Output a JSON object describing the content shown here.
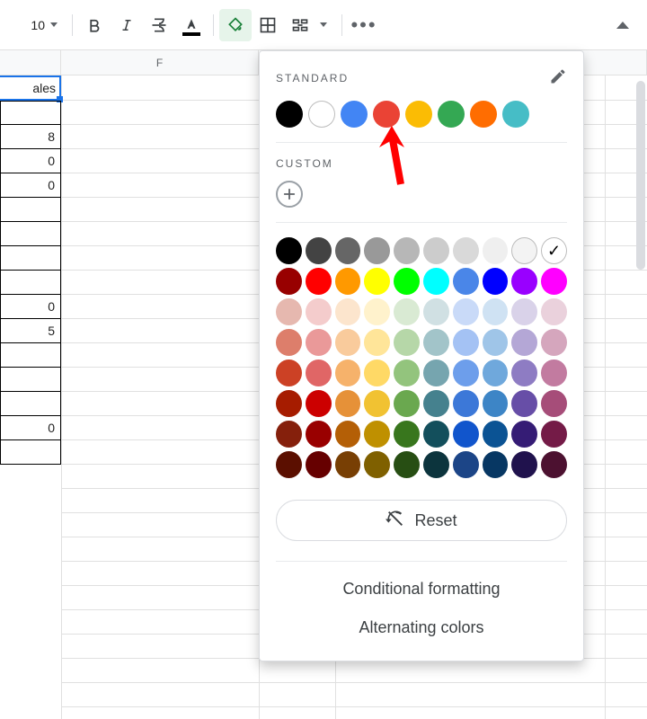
{
  "toolbar": {
    "font_size": "10"
  },
  "columns": {
    "f_label": "F"
  },
  "selected_cell": {
    "text": "ales"
  },
  "data_cells": [
    "",
    "8",
    "0",
    "0",
    "",
    "",
    "",
    "",
    "0",
    "5",
    "",
    "",
    "",
    "0",
    ""
  ],
  "popup": {
    "standard_label": "STANDARD",
    "custom_label": "CUSTOM",
    "reset_label": "Reset",
    "conditional_label": "Conditional formatting",
    "alternating_label": "Alternating colors",
    "standard_colors": [
      "#000000",
      "#ffffff",
      "#4285f4",
      "#ea4335",
      "#fbbc04",
      "#34a853",
      "#ff6d01",
      "#46bdc6"
    ],
    "palette_rows": [
      [
        "#000000",
        "#434343",
        "#666666",
        "#999999",
        "#b7b7b7",
        "#cccccc",
        "#d9d9d9",
        "#efefef",
        "#f3f3f3",
        "check-white"
      ],
      [
        "#980000",
        "#ff0000",
        "#ff9900",
        "#ffff00",
        "#00ff00",
        "#00ffff",
        "#4a86e8",
        "#0000ff",
        "#9900ff",
        "#ff00ff"
      ],
      [
        "#e6b8af",
        "#f4cccc",
        "#fce5cd",
        "#fff2cc",
        "#d9ead3",
        "#d0e0e3",
        "#c9daf8",
        "#cfe2f3",
        "#d9d2e9",
        "#ead1dc"
      ],
      [
        "#dd7e6b",
        "#ea9999",
        "#f9cb9c",
        "#ffe599",
        "#b6d7a8",
        "#a2c4c9",
        "#a4c2f4",
        "#9fc5e8",
        "#b4a7d6",
        "#d5a6bd"
      ],
      [
        "#cc4125",
        "#e06666",
        "#f6b26b",
        "#ffd966",
        "#93c47d",
        "#76a5af",
        "#6d9eeb",
        "#6fa8dc",
        "#8e7cc3",
        "#c27ba0"
      ],
      [
        "#a61c00",
        "#cc0000",
        "#e69138",
        "#f1c232",
        "#6aa84f",
        "#45818e",
        "#3c78d8",
        "#3d85c6",
        "#674ea7",
        "#a64d79"
      ],
      [
        "#85200c",
        "#990000",
        "#b45f06",
        "#bf9000",
        "#38761d",
        "#134f5c",
        "#1155cc",
        "#0b5394",
        "#351c75",
        "#741b47"
      ],
      [
        "#5b0f00",
        "#660000",
        "#783f04",
        "#7f6000",
        "#274e13",
        "#0c343d",
        "#1c4587",
        "#073763",
        "#20124d",
        "#4c1130"
      ]
    ]
  }
}
